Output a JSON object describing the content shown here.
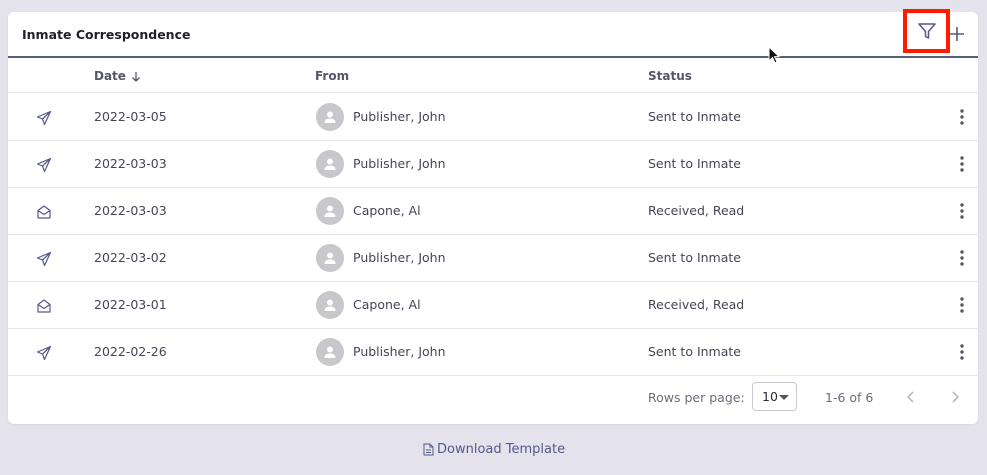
{
  "card": {
    "title": "Inmate Correspondence"
  },
  "table": {
    "headers": {
      "date": "Date",
      "from": "From",
      "status": "Status"
    },
    "rows": [
      {
        "type_icon": "send-icon",
        "date": "2022-03-05",
        "from": "Publisher, John",
        "status": "Sent to Inmate"
      },
      {
        "type_icon": "send-icon",
        "date": "2022-03-03",
        "from": "Publisher, John",
        "status": "Sent to Inmate"
      },
      {
        "type_icon": "open-envelope-icon",
        "date": "2022-03-03",
        "from": "Capone, Al",
        "status": "Received, Read"
      },
      {
        "type_icon": "send-icon",
        "date": "2022-03-02",
        "from": "Publisher, John",
        "status": "Sent to Inmate"
      },
      {
        "type_icon": "open-envelope-icon",
        "date": "2022-03-01",
        "from": "Capone, Al",
        "status": "Received, Read"
      },
      {
        "type_icon": "send-icon",
        "date": "2022-02-26",
        "from": "Publisher, John",
        "status": "Sent to Inmate"
      }
    ]
  },
  "pagination": {
    "rows_per_page_label": "Rows per page:",
    "rows_per_page_value": "10",
    "range": "1-6 of 6"
  },
  "download_link": "Download Template",
  "colors": {
    "highlight": "#ff1a00",
    "header_rule": "#5a5f79",
    "accent": "#55598a"
  }
}
